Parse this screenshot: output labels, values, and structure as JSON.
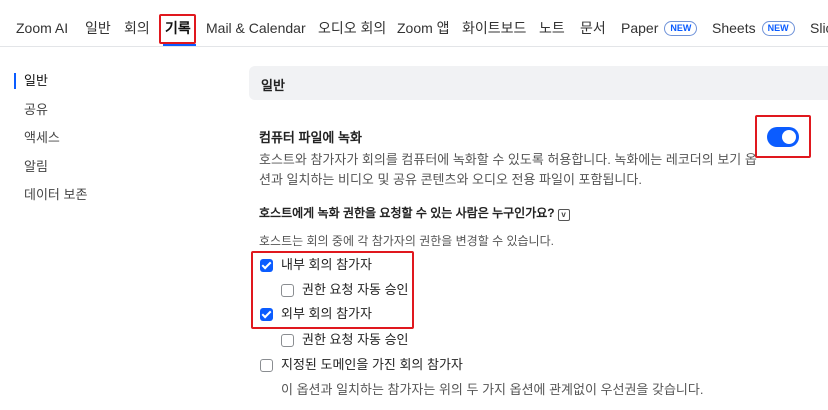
{
  "topnav": {
    "tabs": [
      {
        "label": "Zoom AI"
      },
      {
        "label": "일반"
      },
      {
        "label": "회의"
      },
      {
        "label": "기록",
        "active": true
      },
      {
        "label": "Mail & Calendar"
      },
      {
        "label": "오디오 회의"
      },
      {
        "label": "Zoom 앱"
      },
      {
        "label": "화이트보드"
      },
      {
        "label": "노트"
      },
      {
        "label": "문서"
      },
      {
        "label": "Paper",
        "badge": "NEW"
      },
      {
        "label": "Sheets",
        "badge": "NEW"
      },
      {
        "label": "Slic"
      }
    ]
  },
  "sidebar": {
    "items": [
      {
        "label": "일반",
        "active": true
      },
      {
        "label": "공유"
      },
      {
        "label": "액세스"
      },
      {
        "label": "알림"
      },
      {
        "label": "데이터 보존"
      }
    ]
  },
  "section": {
    "title": "일반"
  },
  "setting": {
    "title": "컴퓨터 파일에 녹화",
    "description_line1": "호스트와 참가자가 회의를 컴퓨터에 녹화할 수 있도록 허용합니다. 녹화에는 레코더의 보기 옵",
    "description_line2": "션과 일치하는 비디오 및 공유 콘텐츠와 오디오 전용 파일이 포함됩니다.",
    "toggle_on": true,
    "question": "호스트에게 녹화 권한을 요청할 수 있는 사람은 누구인가요?",
    "question_info_icon": "v",
    "question_note": "호스트는 회의 중에 각 참가자의 권한을 변경할 수 있습니다.",
    "options": [
      {
        "label": "내부 회의 참가자",
        "checked": true
      },
      {
        "label": "권한 요청 자동 승인",
        "checked": false
      },
      {
        "label": "외부 회의 참가자",
        "checked": true
      },
      {
        "label": "권한 요청 자동 승인",
        "checked": false
      },
      {
        "label": "지정된 도메인을 가진 회의 참가자",
        "checked": false
      }
    ],
    "domain_note": "이 옵션과 일치하는 참가자는 위의 두 가지 옵션에 관계없이 우선권을 갖습니다."
  },
  "colors": {
    "accent": "#0b5cff",
    "highlight": "#e0181e"
  }
}
